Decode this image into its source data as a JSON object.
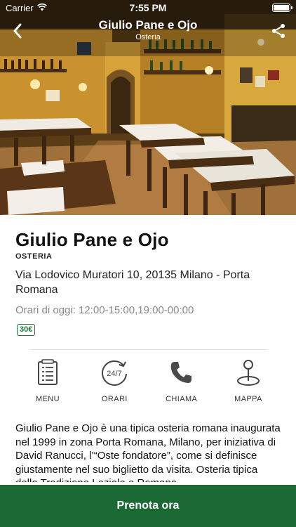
{
  "status_bar": {
    "carrier": "Carrier",
    "time": "7:55 PM"
  },
  "nav": {
    "title": "Giulio Pane e Ojo",
    "subtitle": "Osteria"
  },
  "restaurant": {
    "name": "Giulio Pane e Ojo",
    "category": "OSTERIA",
    "address": "Via Lodovico Muratori 10, 20135 Milano - Porta Romana",
    "hours": "Orari di oggi: 12:00-15:00,19:00-00:00",
    "price": "30€"
  },
  "actions": [
    {
      "label": "MENU",
      "icon": "menu-list-icon"
    },
    {
      "label": "ORARI",
      "icon": "clock-24-7-icon"
    },
    {
      "label": "CHIAMA",
      "icon": "phone-icon"
    },
    {
      "label": "MAPPA",
      "icon": "map-pin-icon"
    }
  ],
  "description": "Giulio Pane e Ojo è una tipica osteria romana inaugurata nel 1999 in zona Porta Romana, Milano, per iniziativa di David Ranucci, l’“Oste fondatore”, come si definisce giustamente nel suo biglietto da visita. Osteria tipica della Tradizione Laziale e Romana.",
  "cta": {
    "label": "Prenota ora"
  },
  "colors": {
    "brand_green": "#1b6a36",
    "price_green": "#1d7a3a"
  }
}
